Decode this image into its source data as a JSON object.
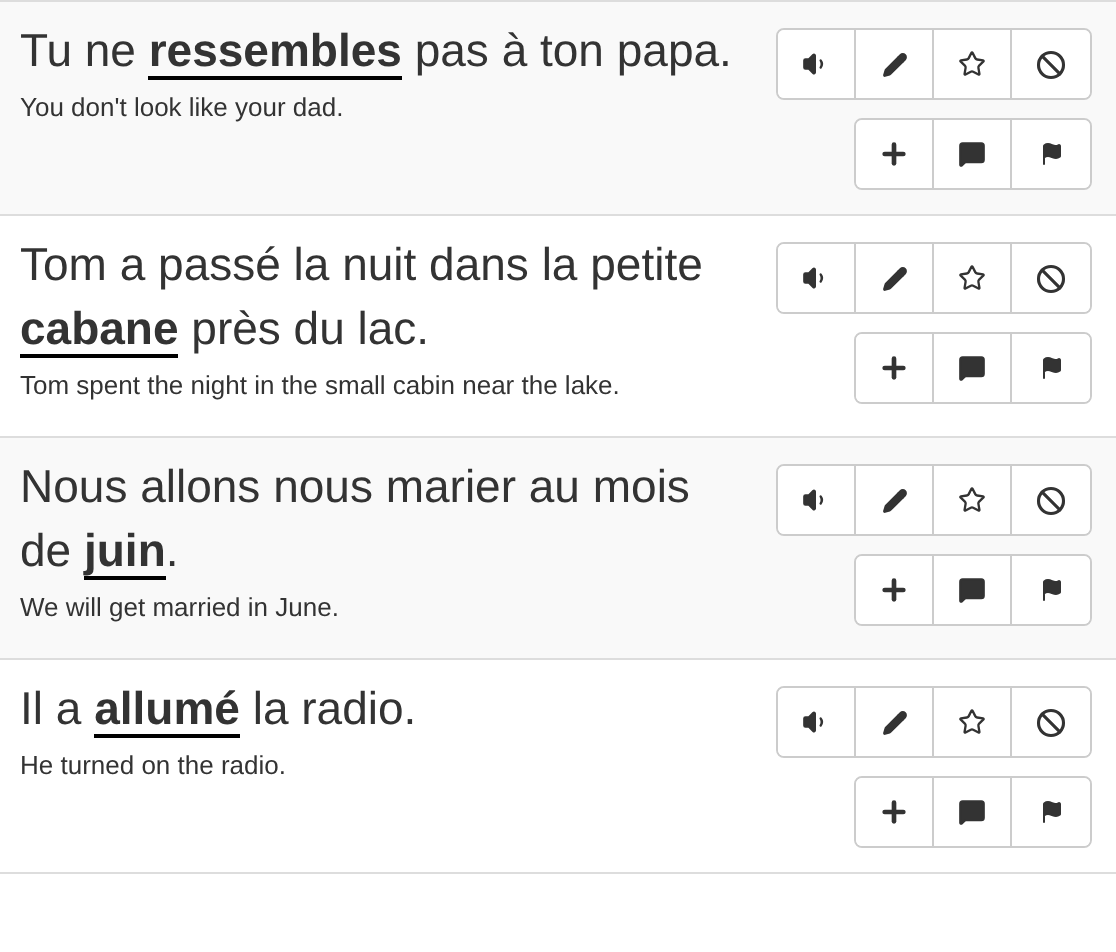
{
  "sentences": [
    {
      "text": "Tu ne **ressembles** pas à ton papa.",
      "translation": "You don't look like your dad."
    },
    {
      "text": "Tom a passé la nuit dans la petite **cabane** près du lac.",
      "translation": "Tom spent the night in the small cabin near the lake."
    },
    {
      "text": "Nous allons nous marier au mois de **juin**.",
      "translation": "We will get married in June."
    },
    {
      "text": "Il a **allumé** la radio.",
      "translation": "He turned on the radio."
    }
  ]
}
